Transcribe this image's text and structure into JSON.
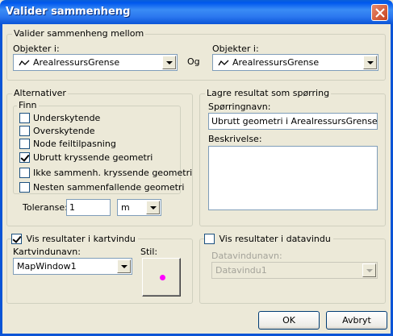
{
  "window": {
    "title": "Valider sammenheng"
  },
  "validate_group": {
    "title": "Valider sammenheng mellom",
    "left_label": "Objekter i:",
    "left_value": "ArealressursGrense",
    "connector": "Og",
    "right_label": "Objekter i:",
    "right_value": "ArealressursGrense"
  },
  "alternatives": {
    "title": "Alternativer",
    "find_title": "Finn",
    "options": [
      {
        "label": "Underskytende",
        "checked": false
      },
      {
        "label": "Overskytende",
        "checked": false
      },
      {
        "label": "Node feiltilpasning",
        "checked": false
      },
      {
        "label": "Ubrutt kryssende geometri",
        "checked": true
      },
      {
        "label": "Ikke sammenh. kryssende geometri",
        "checked": false
      },
      {
        "label": "Nesten sammenfallende geometri",
        "checked": false
      }
    ],
    "tolerance_label": "Toleranse:",
    "tolerance_value": "1",
    "unit_value": "m"
  },
  "save_group": {
    "title": "Lagre resultat som spørring",
    "query_name_label": "Spørringnavn:",
    "query_name_value": "Ubrutt geometri i ArealressursGrense",
    "description_label": "Beskrivelse:",
    "description_value": ""
  },
  "map_group": {
    "title": "Vis resultater i kartvindu",
    "checked": true,
    "window_name_label": "Kartvindunavn:",
    "window_name_value": "MapWindow1",
    "style_label": "Stil:",
    "style_color": "#ff00ff"
  },
  "data_group": {
    "title": "Vis resultater i datavindu",
    "checked": false,
    "window_name_label": "Datavindunavn:",
    "window_name_value": "Datavindu1"
  },
  "buttons": {
    "ok": "OK",
    "cancel": "Avbryt"
  },
  "colors": {
    "titlebar": "#0058ee",
    "dialog_bg": "#ece9d8",
    "style_dot": "#ff00ff"
  }
}
